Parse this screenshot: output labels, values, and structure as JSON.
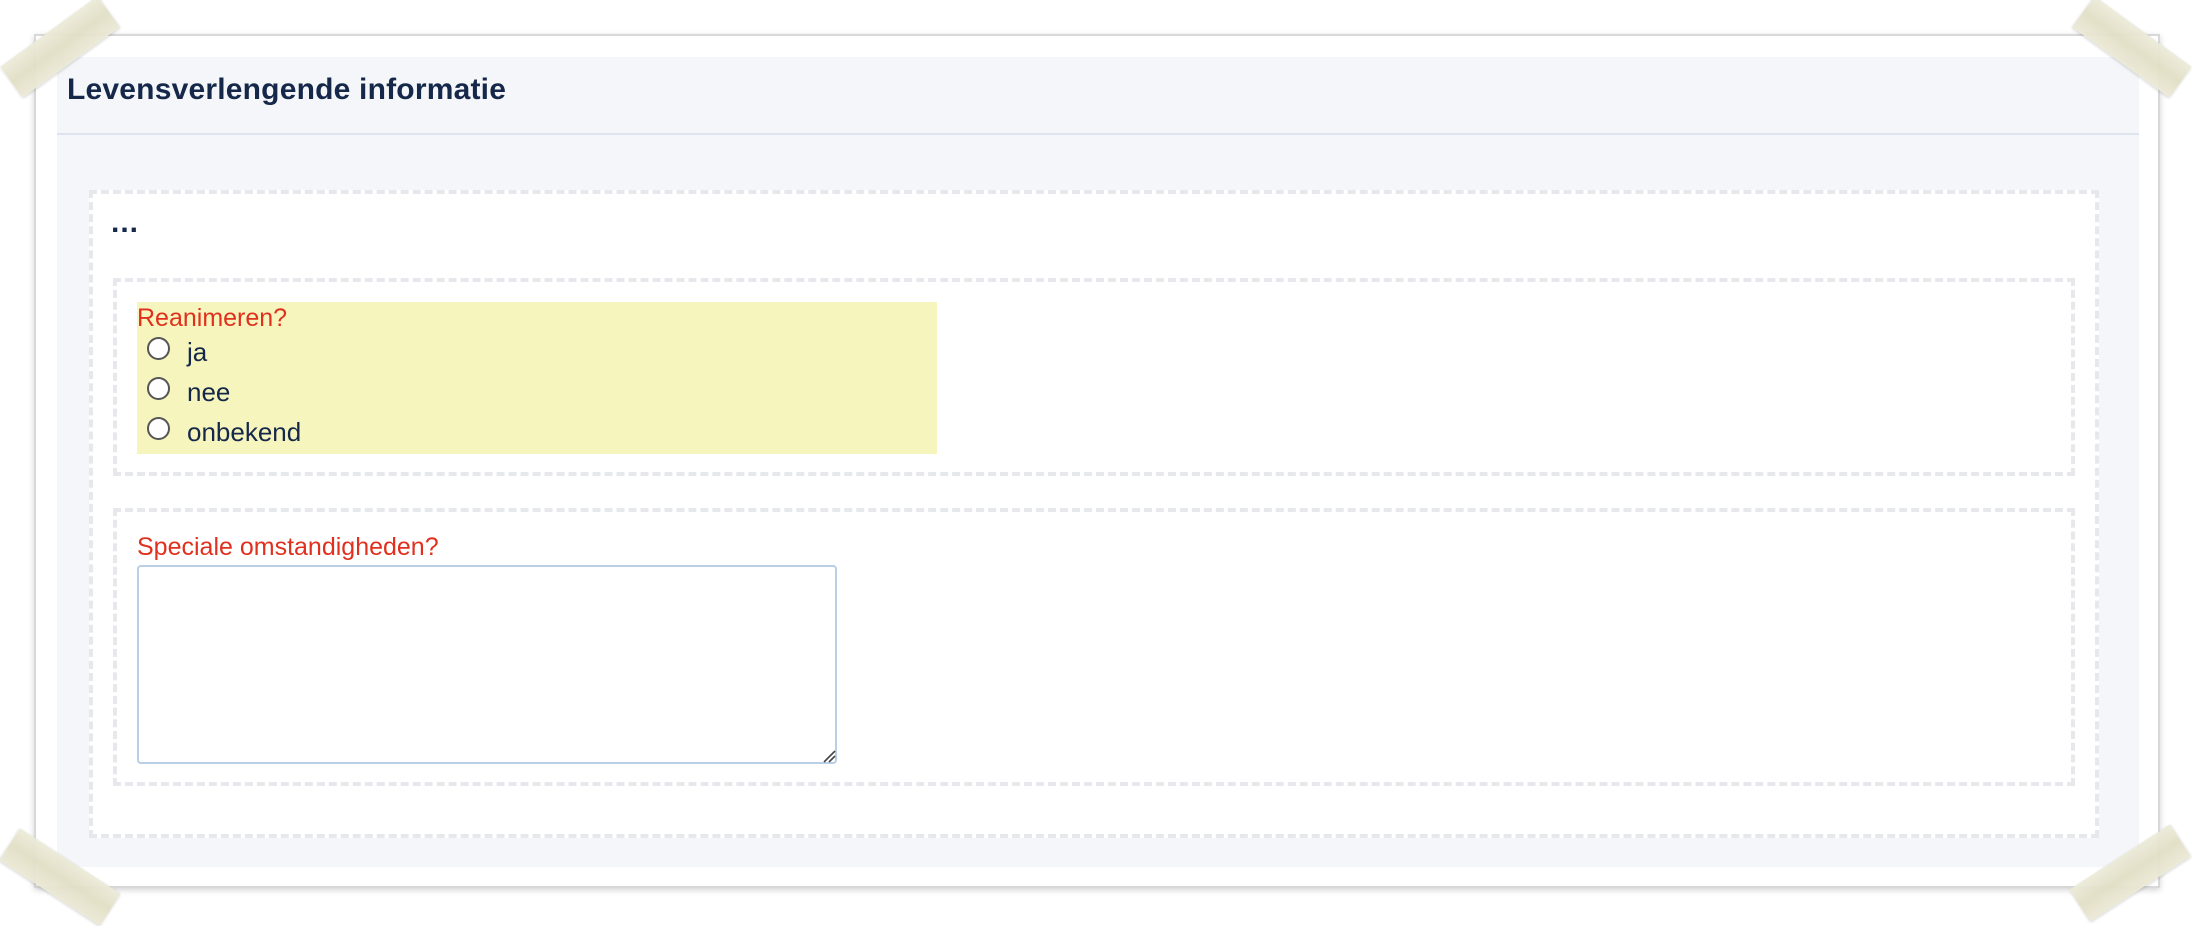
{
  "panel": {
    "title": "Levensverlengende informatie"
  },
  "form": {
    "ellipsis": "...",
    "resuscitate": {
      "label": "Reanimeren?",
      "options": [
        {
          "label": "ja",
          "selected": false
        },
        {
          "label": "nee",
          "selected": false
        },
        {
          "label": "onbekend",
          "selected": false
        }
      ]
    },
    "special_circumstances": {
      "label": "Speciale omstandigheden?",
      "value": ""
    }
  },
  "colors": {
    "title": "#16284a",
    "question_label": "#e0301e",
    "highlight": "#f6f5bd",
    "panel_bg": "#f4f6f9",
    "textarea_border": "#b9cfe6"
  }
}
